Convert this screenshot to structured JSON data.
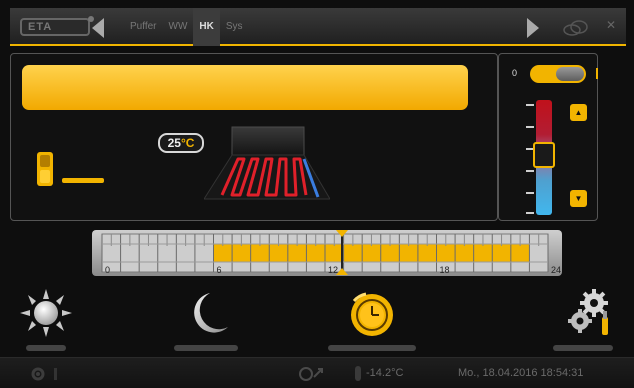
{
  "topbar": {
    "logo_text": "ETA",
    "tabs": [
      {
        "label": "Puffer",
        "active": false
      },
      {
        "label": "WW",
        "active": false
      },
      {
        "label": "HK",
        "active": true
      },
      {
        "label": "Sys",
        "active": false
      }
    ]
  },
  "circuit": {
    "name": "",
    "room_temp_value": "25",
    "room_temp_unit": "°C",
    "pump_running": true
  },
  "control": {
    "toggle_state_label": "0",
    "toggle_on": true,
    "setpoint_level": 0.52
  },
  "timeline": {
    "tick_labels": [
      "0",
      "6",
      "12",
      "18",
      "24"
    ],
    "active_slots": [
      [
        6,
        23
      ]
    ],
    "current_time_hours": 12.9
  },
  "modes": {
    "day_label": "",
    "night_label": "",
    "auto_label": "",
    "settings_label": ""
  },
  "status": {
    "outside_temp": "-14.2°C",
    "datetime": "Mo., 18.04.2016 18:54:31"
  },
  "colors": {
    "accent": "#f2b400",
    "hot": "#c0111b",
    "cold": "#41b7ee",
    "background": "#0e0e0e"
  },
  "icons": {
    "nav_left": "triangle-left-icon",
    "nav_right": "triangle-right-icon",
    "day": "sun-icon",
    "night": "moon-icon",
    "auto": "clock-icon",
    "settings": "gears-icon",
    "connection": "network-icon"
  }
}
